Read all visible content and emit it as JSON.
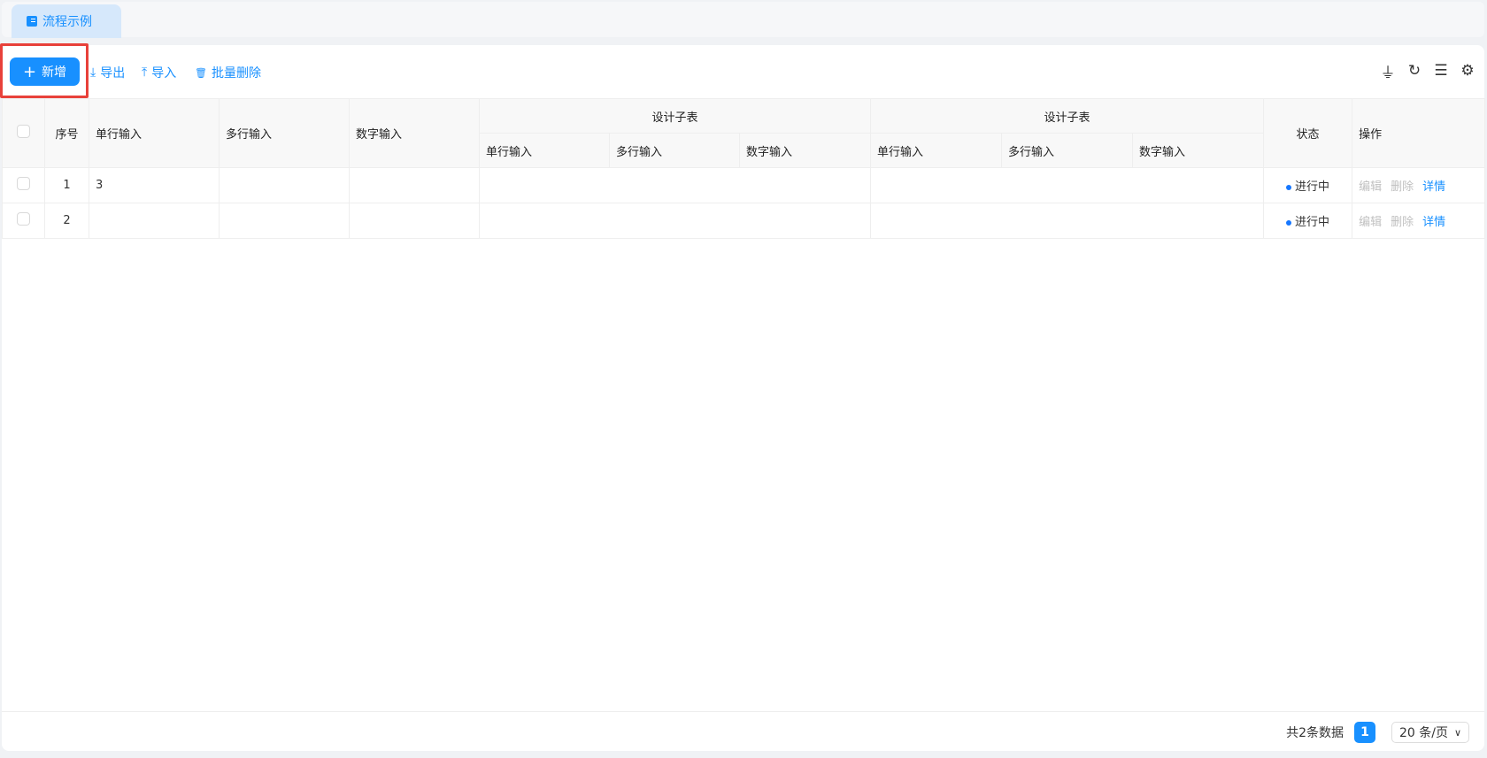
{
  "tab": {
    "label": "流程示例"
  },
  "toolbar": {
    "add": "新增",
    "export": "导出",
    "import": "导入",
    "batch_delete": "批量删除"
  },
  "table": {
    "headers": {
      "index": "序号",
      "single": "单行输入",
      "multi": "多行输入",
      "number": "数字输入",
      "group1": "设计子表",
      "group2": "设计子表",
      "status": "状态",
      "actions": "操作"
    },
    "sub_headers": [
      "单行输入",
      "多行输入",
      "数字输入"
    ],
    "rows": [
      {
        "index": "1",
        "single": "3",
        "status": "进行中"
      },
      {
        "index": "2",
        "single": "",
        "status": "进行中"
      }
    ],
    "actions": {
      "edit": "编辑",
      "delete": "删除",
      "detail": "详情"
    }
  },
  "pagination": {
    "total": "共2条数据",
    "page": "1",
    "size": "20 条/页"
  }
}
